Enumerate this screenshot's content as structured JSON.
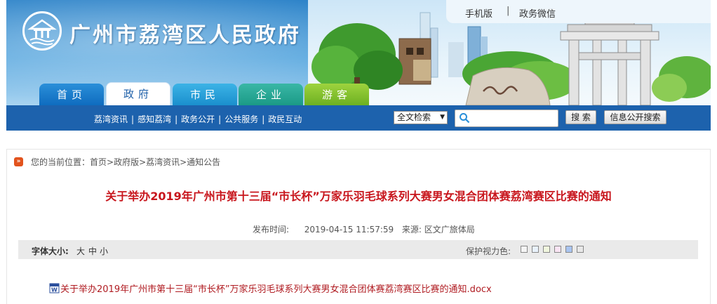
{
  "header": {
    "site_title": "广州市荔湾区人民政府",
    "top_links": [
      "手机版",
      "|",
      "政务微信"
    ],
    "tabs": [
      "首页",
      "政府",
      "市民",
      "企业",
      "游客"
    ]
  },
  "subnav": {
    "links": [
      "荔湾资讯",
      "感知荔湾",
      "政务公开",
      "公共服务",
      "政民互动"
    ],
    "separator": "|",
    "search_scope": "全文检索",
    "search_placeholder": "",
    "search_button": "搜 索",
    "info_search_button": "信息公开搜索"
  },
  "breadcrumb": {
    "label": "您的当前位置：",
    "path": "首页>政府版>荔湾资讯>通知公告"
  },
  "article": {
    "title": "关于举办2019年广州市第十三届“市长杯”万家乐羽毛球系列大赛男女混合团体赛荔湾赛区比赛的通知",
    "published_label": "发布时间:",
    "published_value": "2019-04-15 11:57:59",
    "source_label": "来源:",
    "source_value": "区文广旅体局",
    "attachment": "关于举办2019年广州市第十三届“市长杯”万家乐羽毛球系列大赛男女混合团体赛荔湾赛区比赛的通知.docx"
  },
  "toolbar": {
    "font_size_label": "字体大小:",
    "font_large": "大",
    "font_medium": "中",
    "font_small": "小",
    "eye_care_label": "保护视力色:",
    "eye_colors": [
      "#f4f4f4",
      "#e8f1fb",
      "#f0f6de",
      "#f9e4f3",
      "#a9c4f0",
      "#e8e8e8"
    ]
  },
  "colors": {
    "nav_blue": "#1d62ad",
    "title_red": "#c8161d",
    "link_red": "#b01c22"
  }
}
